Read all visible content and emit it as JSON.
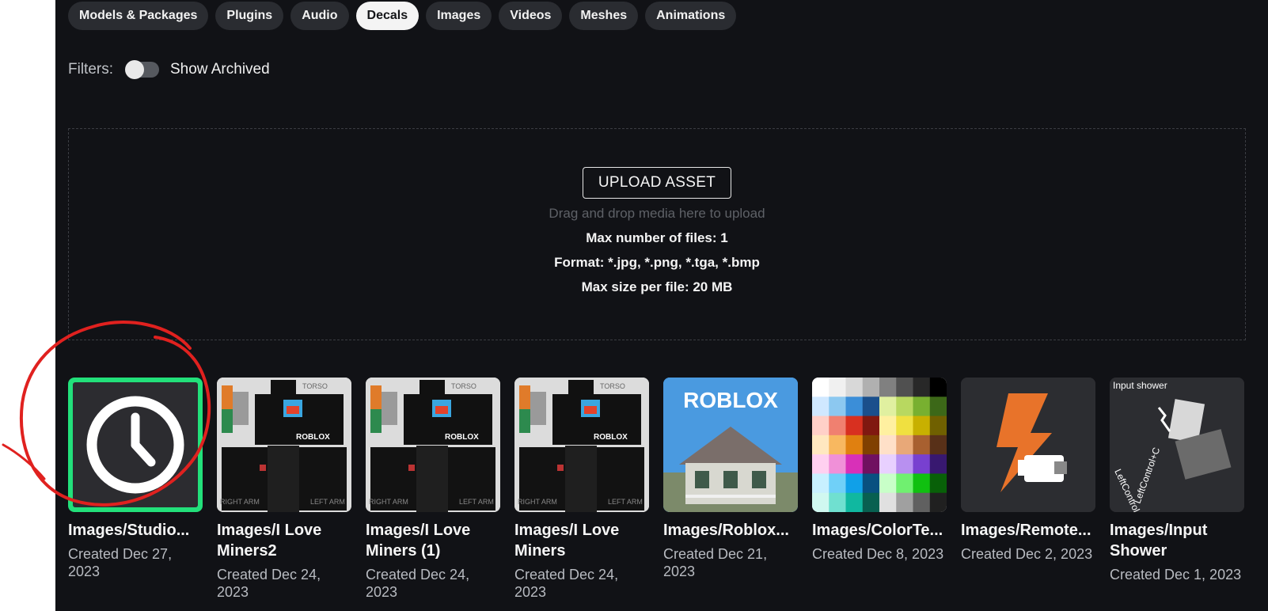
{
  "tabs": [
    {
      "label": "Models & Packages",
      "active": false
    },
    {
      "label": "Plugins",
      "active": false
    },
    {
      "label": "Audio",
      "active": false
    },
    {
      "label": "Decals",
      "active": true
    },
    {
      "label": "Images",
      "active": false
    },
    {
      "label": "Videos",
      "active": false
    },
    {
      "label": "Meshes",
      "active": false
    },
    {
      "label": "Animations",
      "active": false
    }
  ],
  "filters": {
    "label": "Filters:",
    "toggle_label": "Show Archived",
    "toggle_on": false
  },
  "upload": {
    "button_label": "UPLOAD ASSET",
    "drop_hint": "Drag and drop media here to upload",
    "max_files": "Max number of files: 1",
    "format": "Format: *.jpg, *.png, *.tga, *.bmp",
    "max_size": "Max size per file: 20 MB"
  },
  "assets": [
    {
      "title": "Images/Studio...",
      "date": "Created Dec 27, 2023",
      "thumb_icon": "clock-icon"
    },
    {
      "title": "Images/I Love Miners2",
      "date": "Created Dec 24, 2023",
      "thumb_icon": "shirt-template-image",
      "labels": [
        "TORSO",
        "RIGHT ARM",
        "LEFT ARM",
        "ROBLOX"
      ]
    },
    {
      "title": "Images/I Love Miners (1)",
      "date": "Created Dec 24, 2023",
      "thumb_icon": "shirt-template-image",
      "labels": [
        "TORSO",
        "RIGHT ARM",
        "LEFT ARM",
        "ROBLOX"
      ]
    },
    {
      "title": "Images/I Love Miners",
      "date": "Created Dec 24, 2023",
      "thumb_icon": "shirt-template-image",
      "labels": [
        "TORSO",
        "RIGHT ARM",
        "LEFT ARM",
        "ROBLOX"
      ]
    },
    {
      "title": "Images/Roblox...",
      "date": "Created Dec 21, 2023",
      "thumb_icon": "roblox-house-image",
      "labels": [
        "ROBLOX"
      ]
    },
    {
      "title": "Images/ColorTe...",
      "date": "Created Dec 8, 2023",
      "thumb_icon": "color-palette-image"
    },
    {
      "title": "Images/Remote...",
      "date": "Created Dec 2, 2023",
      "thumb_icon": "lightning-remote-icon"
    },
    {
      "title": "Images/Input Shower",
      "date": "Created Dec 1, 2023",
      "thumb_icon": "input-shower-image",
      "labels": [
        "Input shower",
        "LeftControl+C",
        "LeftControl+V"
      ]
    }
  ],
  "colors": {
    "accent_green": "#22e07a",
    "annotation_red": "#e0211f",
    "background": "#111216"
  }
}
